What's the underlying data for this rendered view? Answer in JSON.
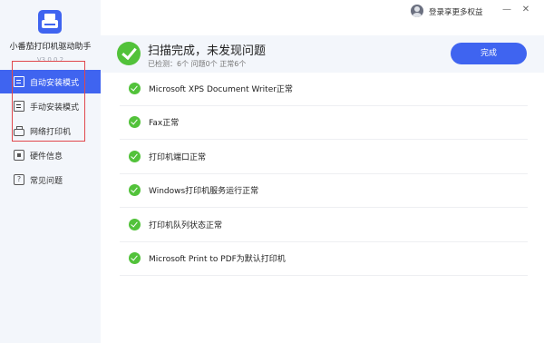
{
  "app": {
    "name": "小番茄打印机驱动助手",
    "version": "V3.0.0.2"
  },
  "sidebar": {
    "items": [
      {
        "label": "自动安装模式",
        "icon": "doc-icon",
        "active": true
      },
      {
        "label": "手动安装模式",
        "icon": "doc-icon",
        "active": false
      },
      {
        "label": "网络打印机",
        "icon": "printer-icon",
        "active": false
      },
      {
        "label": "硬件信息",
        "icon": "chip-icon",
        "active": false
      },
      {
        "label": "常见问题",
        "icon": "help-icon",
        "active": false
      }
    ]
  },
  "topbar": {
    "login_label": "登录享更多权益",
    "min_symbol": "—",
    "close_symbol": "✕"
  },
  "summary": {
    "title": "扫描完成，未发现问题",
    "subtitle": "已检测：6个  问题0个  正常6个",
    "done_label": "完成"
  },
  "results": [
    {
      "text": "Microsoft XPS Document Writer正常"
    },
    {
      "text": "Fax正常"
    },
    {
      "text": "打印机端口正常"
    },
    {
      "text": "Windows打印机服务运行正常"
    },
    {
      "text": "打印机队列状态正常"
    },
    {
      "text": "Microsoft Print to PDF为默认打印机"
    }
  ],
  "colors": {
    "accent": "#3f64f0",
    "success": "#52c23a",
    "highlight": "#e0474c"
  }
}
